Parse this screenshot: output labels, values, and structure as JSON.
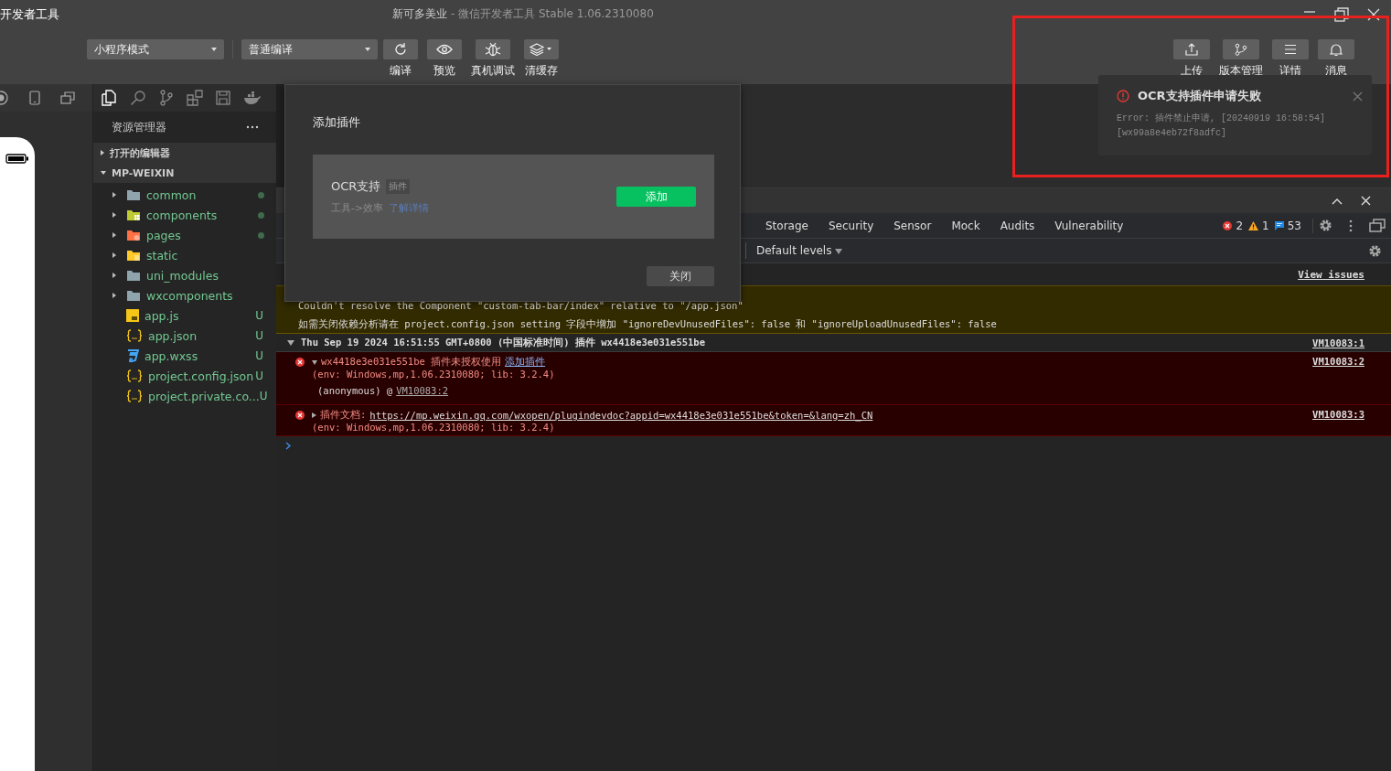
{
  "window": {
    "app_name": "开发者工具",
    "title": "新可多美业",
    "subtitle": "- 微信开发者工具 Stable 1.06.2310080"
  },
  "toolbar": {
    "mode_select": "小程序模式",
    "compile_select": "普通编译",
    "actions": [
      {
        "kind": "refresh",
        "label": "编译"
      },
      {
        "kind": "preview",
        "label": "预览"
      },
      {
        "kind": "debug",
        "label": "真机调试"
      },
      {
        "kind": "cache",
        "label": "清缓存"
      }
    ],
    "right_actions": [
      {
        "kind": "upload",
        "label": "上传"
      },
      {
        "kind": "branch",
        "label": "版本管理"
      },
      {
        "kind": "list",
        "label": "详情"
      },
      {
        "kind": "bell",
        "label": "消息"
      }
    ]
  },
  "activity_bar": [
    {
      "kind": "files",
      "selected": true
    },
    {
      "kind": "search",
      "selected": false
    },
    {
      "kind": "branch",
      "selected": false
    },
    {
      "kind": "blocks",
      "selected": false
    },
    {
      "kind": "disk",
      "selected": false
    },
    {
      "kind": "whale",
      "selected": false
    }
  ],
  "explorer": {
    "title": "资源管理器",
    "sections": [
      {
        "label": "打开的编辑器",
        "expanded": false
      },
      {
        "label": "MP-WEIXIN",
        "expanded": true
      }
    ],
    "items": [
      {
        "name": "common",
        "kind": "folder",
        "dot": true
      },
      {
        "name": "components",
        "kind": "folder-components",
        "dot": true
      },
      {
        "name": "pages",
        "kind": "folder-pages",
        "dot": true
      },
      {
        "name": "static",
        "kind": "folder-static",
        "dot": false
      },
      {
        "name": "uni_modules",
        "kind": "folder",
        "dot": false
      },
      {
        "name": "wxcomponents",
        "kind": "folder",
        "dot": false
      },
      {
        "name": "app.js",
        "kind": "js",
        "badge": "U"
      },
      {
        "name": "app.json",
        "kind": "json",
        "badge": "U"
      },
      {
        "name": "app.wxss",
        "kind": "css",
        "badge": "U"
      },
      {
        "name": "project.config.json",
        "kind": "json",
        "badge": "U"
      },
      {
        "name": "project.private.co...",
        "kind": "json",
        "badge": "U"
      }
    ]
  },
  "devtools": {
    "tabs": [
      {
        "label": "Storage",
        "selected": false
      },
      {
        "label": "Security",
        "selected": false
      },
      {
        "label": "Sensor",
        "selected": false
      },
      {
        "label": "Mock",
        "selected": false
      },
      {
        "label": "Audits",
        "selected": false
      },
      {
        "label": "Vulnerability",
        "selected": false
      }
    ],
    "errors": "2",
    "warnings": "1",
    "messages": "53",
    "levels": "Default levels",
    "view_issues": "View issues",
    "console": [
      {
        "kind": "warning",
        "lines": [
          "Couldn't resolve the Component \"custom-tab-bar/index\" relative to \"/app.json\"",
          "如需关闭依赖分析请在 project.config.json setting 字段中增加 \"ignoreDevUnusedFiles\": false 和 \"ignoreUploadUnusedFiles\": false"
        ]
      },
      {
        "kind": "group",
        "text": "Thu Sep 19 2024 16:51:55 GMT+0800 (中国标准时间) 插件 wx4418e3e031e551be",
        "source": "VM10083:1",
        "expanded": true
      },
      {
        "kind": "error",
        "text": "wx4418e3e031e551be 插件未授权使用",
        "link": "添加插件",
        "detail": "(env: Windows,mp,1.06.2310080; lib: 3.2.4)",
        "stack": "(anonymous) @",
        "stack_link": "VM10083:2",
        "source": "VM10083:2",
        "expanded": true
      },
      {
        "kind": "error",
        "text": "插件文档:",
        "link": "https://mp.weixin.qq.com/wxopen/plugindevdoc?appid=wx4418e3e031e551be&token=&lang=zh_CN",
        "detail": "(env: Windows,mp,1.06.2310080; lib: 3.2.4)",
        "source": "VM10083:3",
        "expanded": false
      }
    ]
  },
  "dialog": {
    "title": "添加插件",
    "plugin_name": "OCR支持",
    "tag": "插件",
    "category": "工具->效率",
    "link": "了解详情",
    "add_button": "添加",
    "close_button": "关闭"
  },
  "notification": {
    "title": "OCR支持插件申请失败",
    "message": "Error: 插件禁止申请, [20240919 16:58:54] [wx99a8e4eb72f8adfc]"
  }
}
